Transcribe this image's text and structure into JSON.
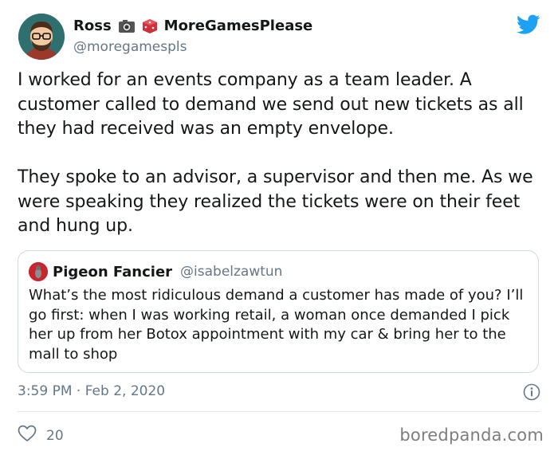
{
  "tweet": {
    "author_name": "Ross",
    "author_badge": "MoreGamesPlease",
    "author_handle": "@moregamespls",
    "author_emoji_icons": [
      "camera-icon",
      "dice-icon"
    ],
    "text_paragraph_1": "I worked for an events company as a team leader. A customer called to demand we send out new tickets as all they had received was an empty envelope.",
    "text_paragraph_2": "They spoke to an advisor, a supervisor and then me. As we were speaking they realized the tickets were on their feet and hung up.",
    "timestamp": "3:59 PM · Feb 2, 2020",
    "like_count": "20"
  },
  "quoted_tweet": {
    "author_name": "Pigeon Fancier",
    "author_handle": "@isabelzawtun",
    "text": "What’s the most ridiculous demand a customer has made of you? I’ll go first: when I was working retail, a woman once demanded I pick her up from her Botox appointment with my car & bring her to the mall to shop"
  },
  "watermark": "boredpanda.com",
  "colors": {
    "twitter_blue": "#1da1f2",
    "secondary_text": "#657786",
    "border": "#cfd9de"
  }
}
